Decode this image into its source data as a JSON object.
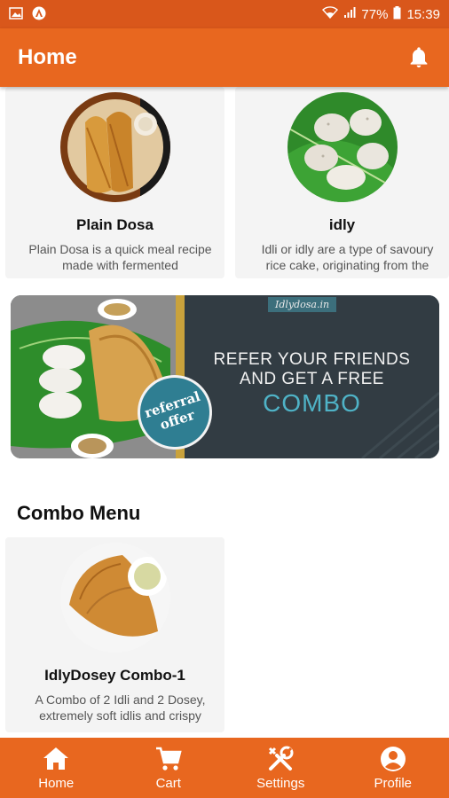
{
  "status_bar": {
    "battery": "77%",
    "time": "15:39",
    "icons": [
      "gallery-icon",
      "app-icon",
      "wifi-icon",
      "signal-icon",
      "battery-icon"
    ]
  },
  "app_bar": {
    "title": "Home",
    "icon": "bell-icon"
  },
  "products": [
    {
      "name": "Plain Dosa",
      "desc": "Plain Dosa is a quick meal recipe made with fermented"
    },
    {
      "name": "idly",
      "desc": "Idli or idly are a type of savoury rice cake, originating from the"
    }
  ],
  "banner": {
    "brand": "Idlydosa.in",
    "line1": "REFER YOUR FRIENDS",
    "line2": "AND GET A FREE",
    "line3": "COMBO",
    "badge_line1": "referral",
    "badge_line2": "offer"
  },
  "combo_section": {
    "title": "Combo Menu",
    "items": [
      {
        "name": "IdlyDosey Combo-1",
        "desc": "A Combo of 2 Idli and 2 Dosey, extremely soft idlis and crispy"
      }
    ]
  },
  "bottom_nav": [
    {
      "label": "Home",
      "icon": "home-icon"
    },
    {
      "label": "Cart",
      "icon": "cart-icon"
    },
    {
      "label": "Settings",
      "icon": "settings-icon"
    },
    {
      "label": "Profile",
      "icon": "profile-icon"
    }
  ],
  "colors": {
    "primary": "#e8671f",
    "status_bar": "#d9571b",
    "banner_dark": "#323c43",
    "banner_accent": "#4fb3c7"
  }
}
